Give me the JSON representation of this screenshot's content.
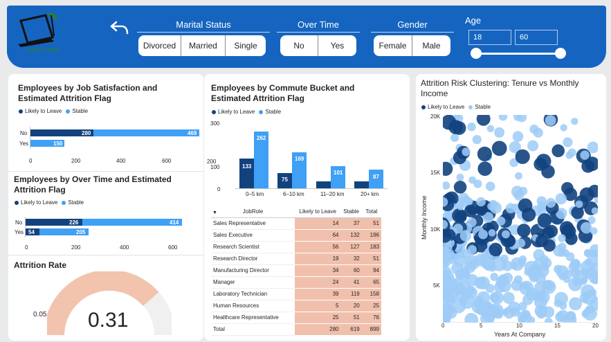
{
  "header": {
    "logo_text": "CODE & RUN",
    "back_icon": "back-arrow-icon",
    "marital": {
      "title": "Marital Status",
      "options": [
        "Divorced",
        "Married",
        "Single"
      ]
    },
    "overtime": {
      "title": "Over Time",
      "options": [
        "No",
        "Yes"
      ]
    },
    "gender": {
      "title": "Gender",
      "options": [
        "Female",
        "Male"
      ]
    },
    "age": {
      "title": "Age",
      "min": "18",
      "max": "60"
    }
  },
  "legend": {
    "likely": "Likely to Leave",
    "stable": "Stable"
  },
  "colors": {
    "likely": "#12427e",
    "stable": "#3fa0f5",
    "scatter_stable": "#9ecbf7",
    "header": "#1565c0",
    "gauge": "#f2c3ad"
  },
  "job_sat": {
    "title": "Employees by Job Satisfaction and Estimated Attrition Flag",
    "categories": [
      "No",
      "Yes"
    ],
    "likely": [
      280,
      0
    ],
    "stable": [
      469,
      150
    ],
    "ticks": [
      "0",
      "200",
      "400",
      "600"
    ]
  },
  "over_time": {
    "title": "Employees by Over Time and Estimated Attrition Flag",
    "categories": [
      "No",
      "Yes"
    ],
    "likely": [
      226,
      54
    ],
    "stable": [
      414,
      205
    ],
    "ticks": [
      "0",
      "200",
      "400",
      "600"
    ]
  },
  "attrition_rate": {
    "title": "Attrition Rate",
    "value": "0.31",
    "target_label": "0.05",
    "fraction": 0.31
  },
  "commute": {
    "title": "Employees by Commute Bucket and Estimated Attrition Flag",
    "categories": [
      "0–5 km",
      "6–10 km",
      "11–20 km",
      "20+ km"
    ],
    "likely": [
      133,
      75,
      null,
      null
    ],
    "stable": [
      262,
      169,
      101,
      87
    ],
    "likely_est": [
      133,
      75,
      40,
      40
    ],
    "ticks": [
      "0",
      "100",
      "200",
      "300"
    ]
  },
  "table": {
    "headers": [
      "JobRole",
      "Likely to Leave",
      "Stable",
      "Total"
    ],
    "rows": [
      [
        "Sales Representative",
        "14",
        "37",
        "51"
      ],
      [
        "Sales Executive",
        "64",
        "132",
        "196"
      ],
      [
        "Research Scientist",
        "56",
        "127",
        "183"
      ],
      [
        "Research Director",
        "19",
        "32",
        "51"
      ],
      [
        "Manufacturing Director",
        "34",
        "60",
        "94"
      ],
      [
        "Manager",
        "24",
        "41",
        "65"
      ],
      [
        "Laboratory Technician",
        "39",
        "119",
        "158"
      ],
      [
        "Human Resources",
        "5",
        "20",
        "25"
      ],
      [
        "Healthcare Representative",
        "25",
        "51",
        "76"
      ]
    ],
    "total": [
      "Total",
      "280",
      "619",
      "899"
    ]
  },
  "scatter": {
    "title": "Attrition Risk Clustering: Tenure vs Monthly Income",
    "xlabel": "Years At Company",
    "ylabel": "Monthly Income",
    "xticks": [
      "0",
      "5",
      "10",
      "15",
      "20"
    ],
    "yticks": [
      "5K",
      "10K",
      "15K",
      "20K"
    ]
  }
}
